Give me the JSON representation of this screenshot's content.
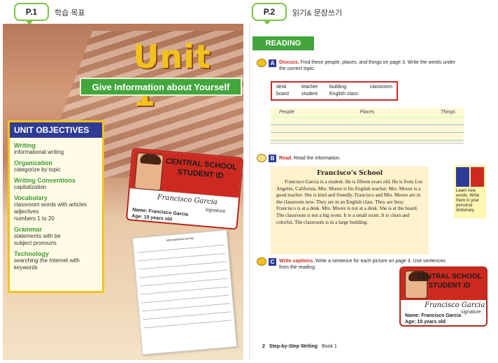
{
  "tabs": {
    "left": {
      "label": "P.1",
      "caption": "학습 목표"
    },
    "right": {
      "label": "P.2",
      "caption": "읽기& 문장쓰기"
    }
  },
  "left_page": {
    "unit_title": "Unit 1",
    "subtitle": "Give Information about Yourself",
    "objectives_header": "UNIT OBJECTIVES",
    "objectives": [
      {
        "category": "Writing",
        "desc": "informational writing"
      },
      {
        "category": "Organization",
        "desc": "categorize by topic"
      },
      {
        "category": "Writing Conventions",
        "desc": "capitalization"
      },
      {
        "category": "Vocabulary",
        "desc": "classroom words with articles\nadjectives\nnumbers 1 to 20"
      },
      {
        "category": "Grammar",
        "desc": "statements with be\nsubject pronouns"
      },
      {
        "category": "Technology",
        "desc": "searching the Internet with\n   keywords"
      }
    ],
    "id_card": {
      "school": "CENTRAL SCHOOL",
      "id": "STUDENT ID",
      "signature": "Francisco Garcia",
      "signature_label": "signature",
      "name": "Name: Francisco Garcia",
      "age": "Age: 15 years old"
    },
    "survey_title": "Informational Survey"
  },
  "right_page": {
    "section_title": "READING",
    "a": {
      "letter": "A",
      "keyword": "Discuss.",
      "text": " Find these people, places, and things on page 3. Write the words under the correct topic."
    },
    "words": [
      "desk",
      "teacher",
      "building",
      "classroom",
      "board",
      "student",
      "English class",
      ""
    ],
    "topics": [
      "People",
      "Places",
      "Things"
    ],
    "b": {
      "letter": "B",
      "keyword": "Read.",
      "text": " Read the information."
    },
    "reading_title": "Francisco’s School",
    "reading_body": "Francisco Garcia is a student. He is fifteen years old. He is from Los Angeles, California. Mrs. Moore is his English teacher. Mrs. Moore is a good teacher. She is kind and friendly. Francisco and Mrs. Moore are in the classroom now. They are in an English class. They are busy. Francisco is at a desk. Mrs. Moore is not at a desk. She is at the board. The classroom is not a big room. It is a small room. It is clean and colorful. The classroom is in a large building.",
    "dict_note": "Learn new words. Write them in your personal dictionary.",
    "c": {
      "letter": "C",
      "keyword": "Write captions.",
      "text": " Write a sentence for each picture on page 3. Use sentences from the reading."
    },
    "id_card": {
      "school": "CENTRAL SCHOOL",
      "id": "STUDENT ID",
      "signature": "Francisco Garcia",
      "signature_label": "signature",
      "name": "Name: Francisco Garcia",
      "age": "Age: 15 years old"
    },
    "footer": {
      "page": "2",
      "book": "Step-by-Step Writing",
      "volume": "Book 1"
    }
  },
  "colors": {
    "green": "#43a63d",
    "navy": "#2f3c96",
    "red": "#cc2a20",
    "yellow": "#f2c21b"
  }
}
